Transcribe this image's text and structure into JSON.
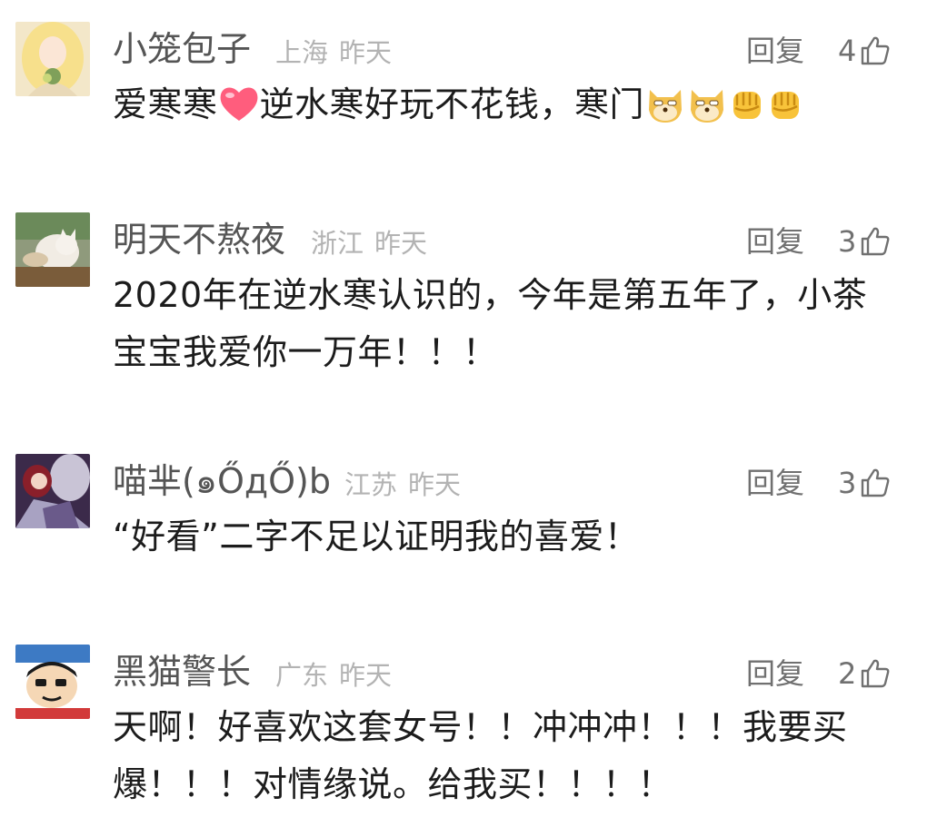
{
  "reply_label": "回复",
  "comments": [
    {
      "username": "小笼包子",
      "location": "上海",
      "time": "昨天",
      "likes": "4",
      "text_parts": [
        "爱寒寒",
        "逆水寒好玩不花钱，寒门"
      ],
      "emoji": [
        "heart-emoji",
        "doge-emoji",
        "doge-emoji",
        "fist-emoji",
        "fist-emoji"
      ]
    },
    {
      "username": "明天不熬夜",
      "location": "浙江",
      "time": "昨天",
      "likes": "3",
      "text_lines": [
        "2020年在逆水寒认识的，今年是第五年了，小茶",
        "宝宝我爱你一万年！！！"
      ]
    },
    {
      "username": "喵芈(๑ŐдŐ)b",
      "location": "江苏",
      "time": "昨天",
      "likes": "3",
      "text_lines": [
        "“好看”二字不足以证明我的喜爱！"
      ]
    },
    {
      "username": "黑猫警长",
      "location": "广东",
      "time": "昨天",
      "likes": "2",
      "text_lines": [
        "天啊！好喜欢这套女号！！冲冲冲！！！我要买",
        "爆！！！对情缘说。给我买！！！！"
      ]
    }
  ],
  "colors": {
    "username": "#555555",
    "meta": "#b3b3b3",
    "action": "#707070",
    "text": "#1c1c1c"
  }
}
